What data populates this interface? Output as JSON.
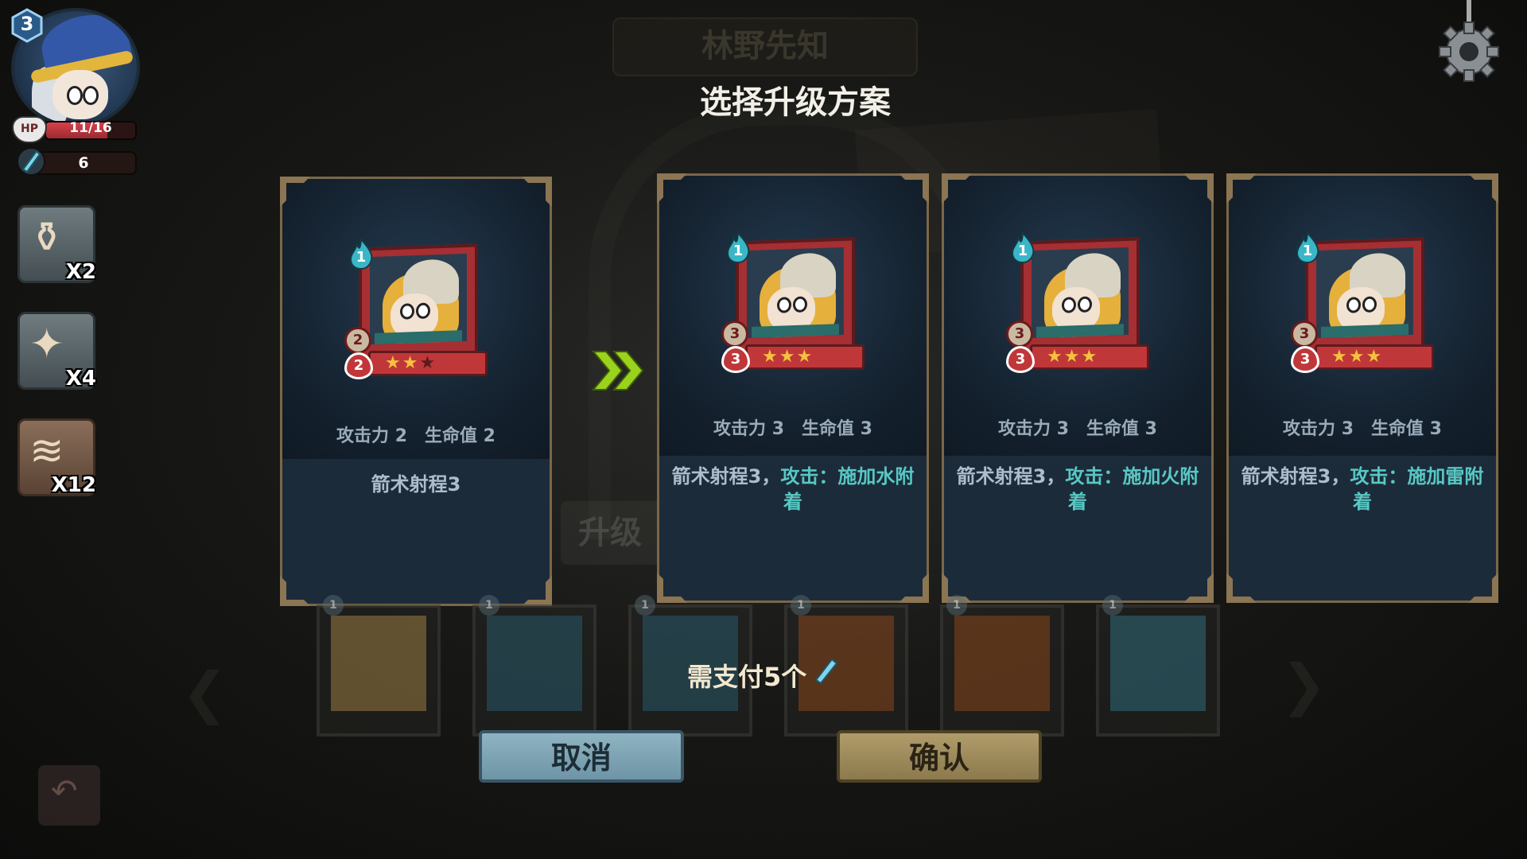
{
  "background": {
    "banner_title": "林野先知",
    "upgrade_label": "升级"
  },
  "dialog": {
    "title": "选择升级方案"
  },
  "hero": {
    "level": "3",
    "hp_label": "HP",
    "hp_text": "11/16",
    "hp_fraction": 0.6875,
    "crystals": "6"
  },
  "inventory": [
    {
      "icon": "potion-icon",
      "count": "X2"
    },
    {
      "icon": "chest-icon",
      "count": "X4"
    },
    {
      "icon": "cards-stack-icon",
      "count": "X12"
    }
  ],
  "current_card": {
    "cost": "1",
    "attack": "2",
    "health": "2",
    "stars_filled": 2,
    "stars_total": 3,
    "stats_attack": "攻击力 2",
    "stats_health": "生命值 2",
    "desc": "箭术射程3"
  },
  "options": [
    {
      "cost": "1",
      "attack": "3",
      "health": "3",
      "stars_filled": 3,
      "stars_total": 3,
      "stats_attack": "攻击力 3",
      "stats_health": "生命值 3",
      "desc_plain": "箭术射程3，",
      "desc_highlight": "攻击：施加水附着"
    },
    {
      "cost": "1",
      "attack": "3",
      "health": "3",
      "stars_filled": 3,
      "stars_total": 3,
      "stats_attack": "攻击力 3",
      "stats_health": "生命值 3",
      "desc_plain": "箭术射程3，",
      "desc_highlight": "攻击：施加火附着"
    },
    {
      "cost": "1",
      "attack": "3",
      "health": "3",
      "stars_filled": 3,
      "stars_total": 3,
      "stats_attack": "攻击力 3",
      "stats_health": "生命值 3",
      "desc_plain": "箭术射程3，",
      "desc_highlight": "攻击：施加雷附着"
    }
  ],
  "bench": [
    {
      "cost": "1"
    },
    {
      "cost": "1"
    },
    {
      "cost": "1"
    },
    {
      "cost": "1"
    },
    {
      "cost": "1"
    },
    {
      "cost": "1"
    }
  ],
  "payment": {
    "text": "需支付5个"
  },
  "buttons": {
    "cancel": "取消",
    "confirm": "确认"
  },
  "colors": {
    "card_border": "#7a6748",
    "highlight_text": "#58c8c4",
    "cancel_button": "#8fb4c2",
    "confirm_button": "#b09c6a"
  }
}
